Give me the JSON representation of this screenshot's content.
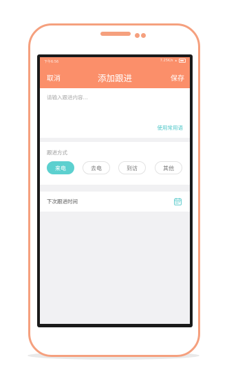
{
  "status_bar": {
    "time": "下午6:56",
    "network": "7.25K/s"
  },
  "header": {
    "cancel_label": "取消",
    "title": "添加跟进",
    "save_label": "保存"
  },
  "note": {
    "placeholder": "请输入跟进内容...",
    "value": "",
    "phrase_link": "使用常用语"
  },
  "follow_method": {
    "label": "跟进方式",
    "options": [
      "来电",
      "去电",
      "到访",
      "其他"
    ],
    "selected": "来电"
  },
  "next_time": {
    "label": "下次跟进时间",
    "icon": "calendar-icon"
  },
  "colors": {
    "accent_header": "#fb8f6a",
    "accent_selected": "#5cd0cf",
    "link": "#4fc7c8",
    "device_outline": "#f5a07e"
  }
}
